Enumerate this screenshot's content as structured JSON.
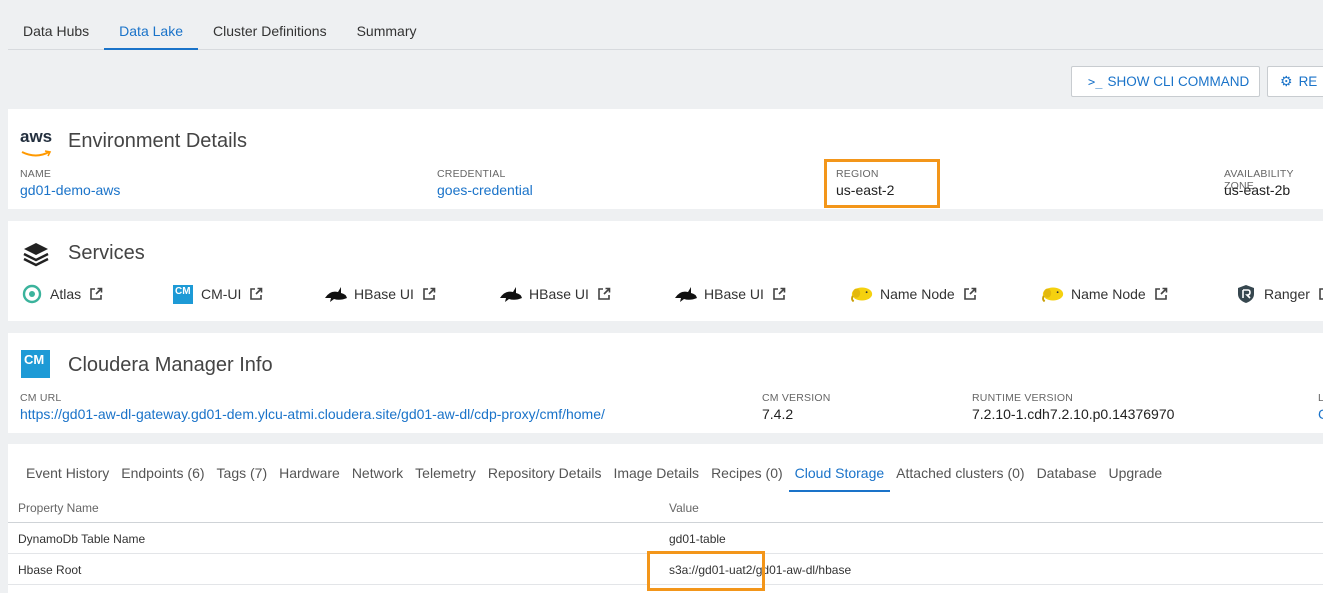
{
  "tabs": [
    "Data Hubs",
    "Data Lake",
    "Cluster Definitions",
    "Summary"
  ],
  "active_tab": "Data Lake",
  "toolbar": {
    "cli_label": "SHOW CLI COMMAND",
    "repair_label": "RE"
  },
  "environment": {
    "logo_text": "aws",
    "title": "Environment Details",
    "fields": [
      {
        "label": "NAME",
        "value": "gd01-demo-aws"
      },
      {
        "label": "CREDENTIAL",
        "value": "goes-credential"
      },
      {
        "label": "REGION",
        "value": "us-east-2"
      },
      {
        "label": "AVAILABILITY ZONE",
        "value": "us-east-2b"
      }
    ]
  },
  "services": {
    "title": "Services",
    "items": [
      {
        "label": "Atlas",
        "icon": "atlas-icon"
      },
      {
        "label": "CM-UI",
        "icon": "cm-icon"
      },
      {
        "label": "HBase UI",
        "icon": "hbase-orca-icon"
      },
      {
        "label": "HBase UI",
        "icon": "hbase-orca-icon"
      },
      {
        "label": "HBase UI",
        "icon": "hbase-orca-icon"
      },
      {
        "label": "Name Node",
        "icon": "hadoop-elephant-icon"
      },
      {
        "label": "Name Node",
        "icon": "hadoop-elephant-icon"
      },
      {
        "label": "Ranger",
        "icon": "ranger-icon"
      }
    ]
  },
  "cm_info": {
    "logo_text": "CM",
    "title": "Cloudera Manager Info",
    "url_label": "CM URL",
    "url": "https://gd01-aw-dl-gateway.gd01-dem.ylcu-atmi.cloudera.site/gd01-aw-dl/cdp-proxy/cmf/home/",
    "version_label": "CM VERSION",
    "version": "7.4.2",
    "runtime_label": "RUNTIME VERSION",
    "runtime": "7.2.10-1.cdh7.2.10.p0.14376970",
    "extra_label": "L",
    "extra_value": "C"
  },
  "detail_tabs": [
    "Event History",
    "Endpoints (6)",
    "Tags (7)",
    "Hardware",
    "Network",
    "Telemetry",
    "Repository Details",
    "Image Details",
    "Recipes (0)",
    "Cloud Storage",
    "Attached clusters (0)",
    "Database",
    "Upgrade"
  ],
  "active_detail_tab": "Cloud Storage",
  "storage_table": {
    "headers": [
      "Property Name",
      "Value"
    ],
    "rows": [
      [
        "DynamoDb Table Name",
        "gd01-table"
      ],
      [
        "Hbase Root",
        "s3a://gd01-uat2/gd01-aw-dl/hbase"
      ]
    ]
  },
  "colors": {
    "accent": "#1a73c9",
    "highlight": "#f3961a",
    "background": "#eef0f2"
  }
}
